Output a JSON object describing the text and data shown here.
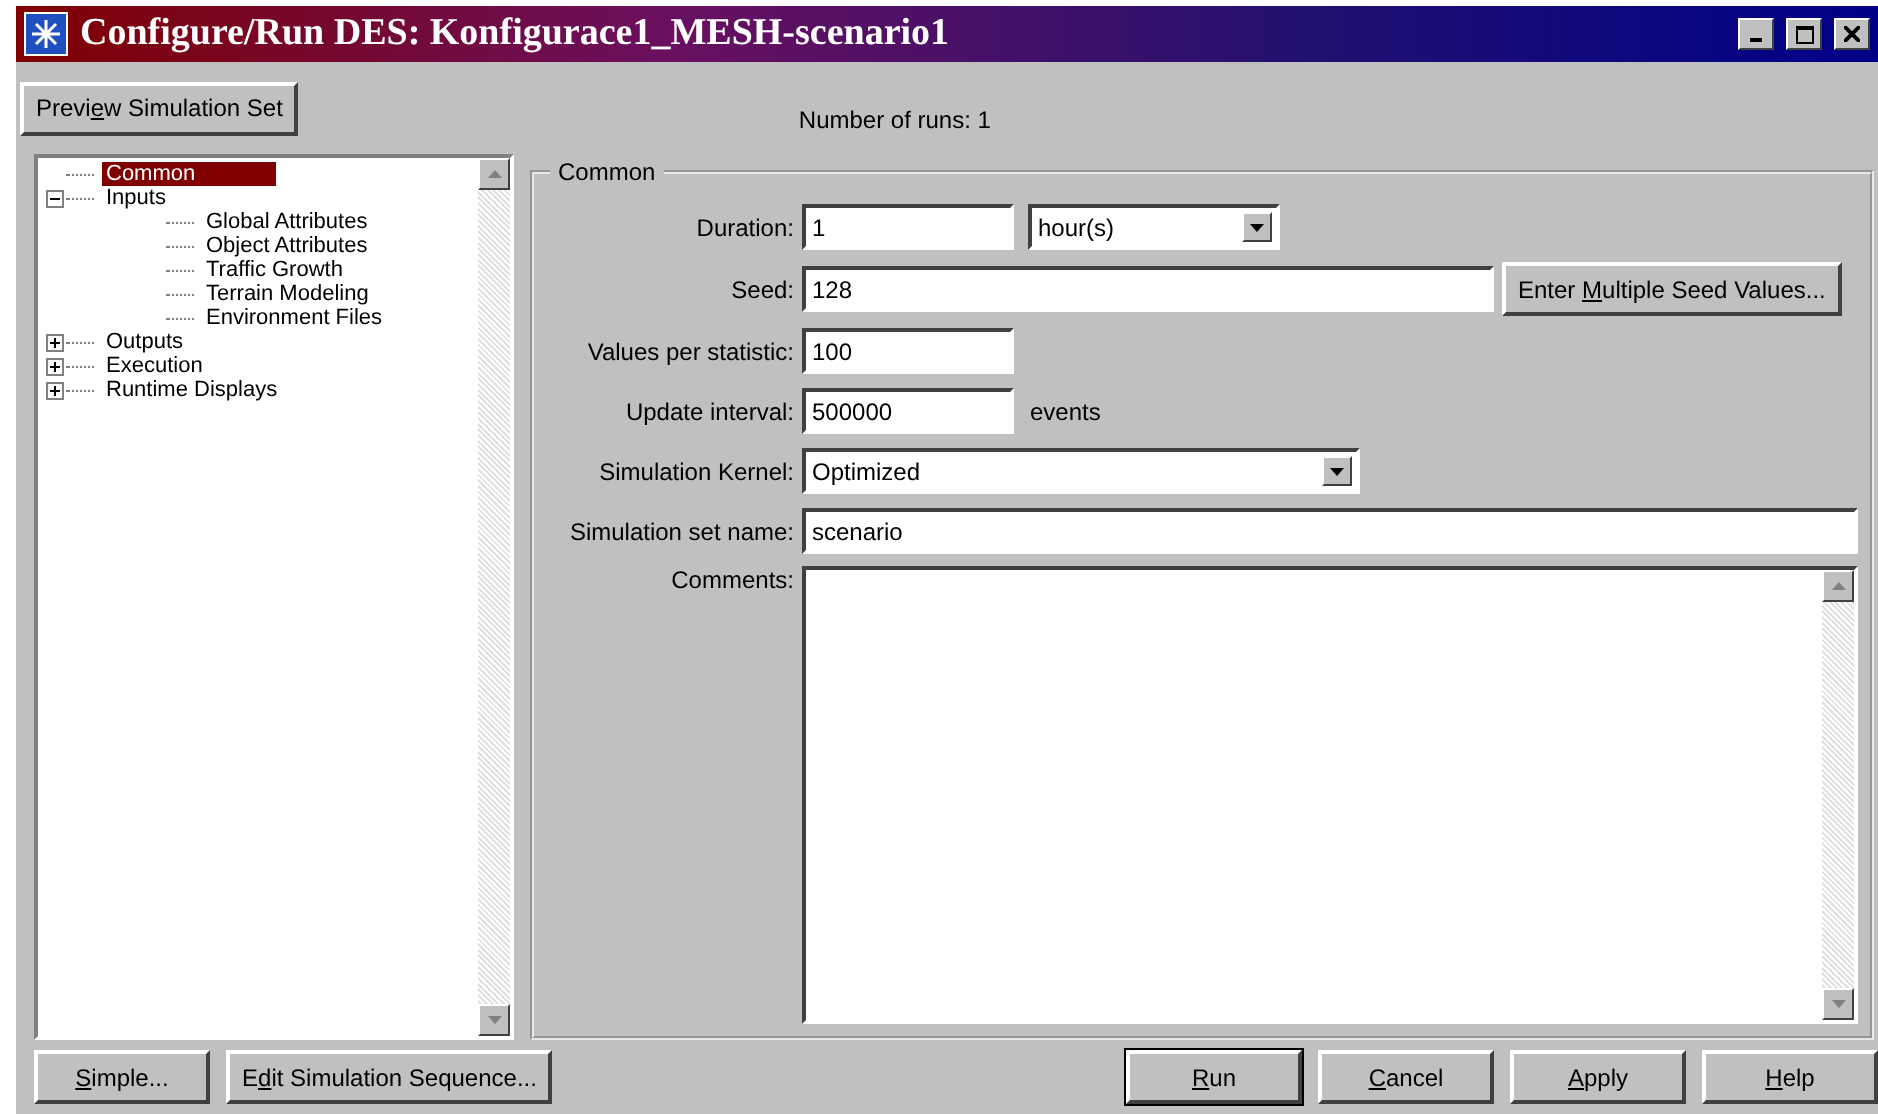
{
  "window": {
    "title": "Configure/Run DES: Konfigurace1_MESH-scenario1"
  },
  "preview_button": {
    "pre": "Previ",
    "key": "e",
    "post": "w Simulation Set"
  },
  "runs_label": "Number of runs: 1",
  "tree": [
    {
      "label": "Common",
      "selected": true
    },
    {
      "label": "Inputs",
      "selected": false,
      "expanded": true,
      "children": [
        {
          "label": "Global Attributes",
          "selected": false
        },
        {
          "label": "Object Attributes",
          "selected": false
        },
        {
          "label": "Traffic Growth",
          "selected": false
        },
        {
          "label": "Terrain Modeling",
          "selected": false
        },
        {
          "label": "Environment Files",
          "selected": false
        }
      ]
    },
    {
      "label": "Outputs",
      "selected": false,
      "expanded": false
    },
    {
      "label": "Execution",
      "selected": false,
      "expanded": false
    },
    {
      "label": "Runtime Displays",
      "selected": false,
      "expanded": false
    }
  ],
  "group": {
    "title": "Common",
    "fields": [
      {
        "kind": "duration",
        "label": "Duration:",
        "value": "1",
        "unit": "hour(s)"
      },
      {
        "kind": "seed",
        "label": "Seed:",
        "value": "128",
        "button": {
          "pre": "Enter ",
          "key": "M",
          "post": "ultiple Seed Values..."
        }
      },
      {
        "kind": "short",
        "label": "Values per statistic:",
        "value": "100"
      },
      {
        "kind": "short",
        "label": "Update interval:",
        "value": "500000",
        "suffix": "events"
      },
      {
        "kind": "select",
        "label": "Simulation Kernel:",
        "value": "Optimized"
      },
      {
        "kind": "wide",
        "label": "Simulation set name:",
        "value": "scenario"
      },
      {
        "kind": "textarea",
        "label": "Comments:"
      }
    ]
  },
  "left_buttons": [
    {
      "key": "S",
      "post": "imple..."
    },
    {
      "pre": "E",
      "key": "d",
      "post": "it Simulation Sequence..."
    }
  ],
  "right_buttons": [
    {
      "key": "R",
      "post": "un",
      "default": true
    },
    {
      "key": "C",
      "post": "ancel",
      "default": false
    },
    {
      "key": "A",
      "post": "pply",
      "default": false
    },
    {
      "key": "H",
      "post": "elp",
      "default": false
    }
  ]
}
